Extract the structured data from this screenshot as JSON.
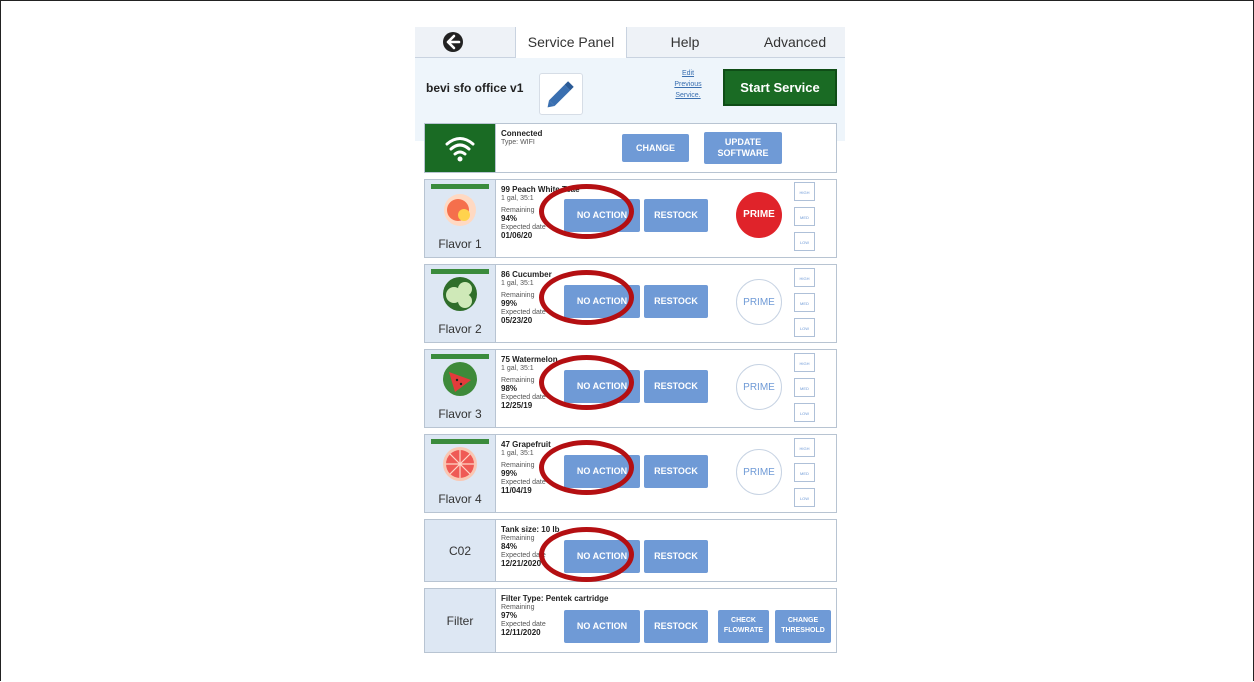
{
  "tabs": {
    "service": "Service Panel",
    "help": "Help",
    "advanced": "Advanced"
  },
  "header": {
    "title": "bevi sfo office v1",
    "edit_link": [
      "Edit",
      "Previous",
      "Service."
    ],
    "start_label": "Start Service"
  },
  "wifi": {
    "status": "Connected",
    "type": "Type: WIFI",
    "change_label": "CHANGE",
    "update_label": [
      "UPDATE",
      "SOFTWARE"
    ]
  },
  "common": {
    "no_action": "NO ACTION",
    "restock": "RESTOCK",
    "prime": "PRIME",
    "high": "HIGH",
    "med": "MED",
    "low": "LOW",
    "remaining": "Remaining",
    "expected": "Expected date",
    "ratio": "1 gal, 35:1"
  },
  "flavors": [
    {
      "label": "Flavor 1",
      "name": "99 Peach White Tea",
      "name_suffix": "e",
      "remaining": "94%",
      "date": "01/06/20",
      "prime_active": true
    },
    {
      "label": "Flavor 2",
      "name": "86 Cucumber",
      "remaining": "99%",
      "date": "05/23/20",
      "prime_active": false
    },
    {
      "label": "Flavor 3",
      "name": "75 Watermelon",
      "remaining": "98%",
      "date": "12/25/19",
      "prime_active": false
    },
    {
      "label": "Flavor 4",
      "name": "47 Grapefruit",
      "remaining": "99%",
      "date": "11/04/19",
      "prime_active": false
    }
  ],
  "co2": {
    "label": "C02",
    "tank": "Tank size: 10 lb",
    "remaining": "84%",
    "date": "12/21/2020"
  },
  "filter": {
    "label": "Filter",
    "type": "Filter Type: Pentek cartridge",
    "remaining": "97%",
    "date": "12/11/2020",
    "check_label": [
      "CHECK",
      "FLOWRATE"
    ],
    "threshold_label": [
      "CHANGE",
      "THRESHOLD"
    ]
  },
  "colors": {
    "start": "#1a6b24",
    "button": "#6f9ad6",
    "prime_active": "#e0232a",
    "annotation": "#b40f12"
  }
}
